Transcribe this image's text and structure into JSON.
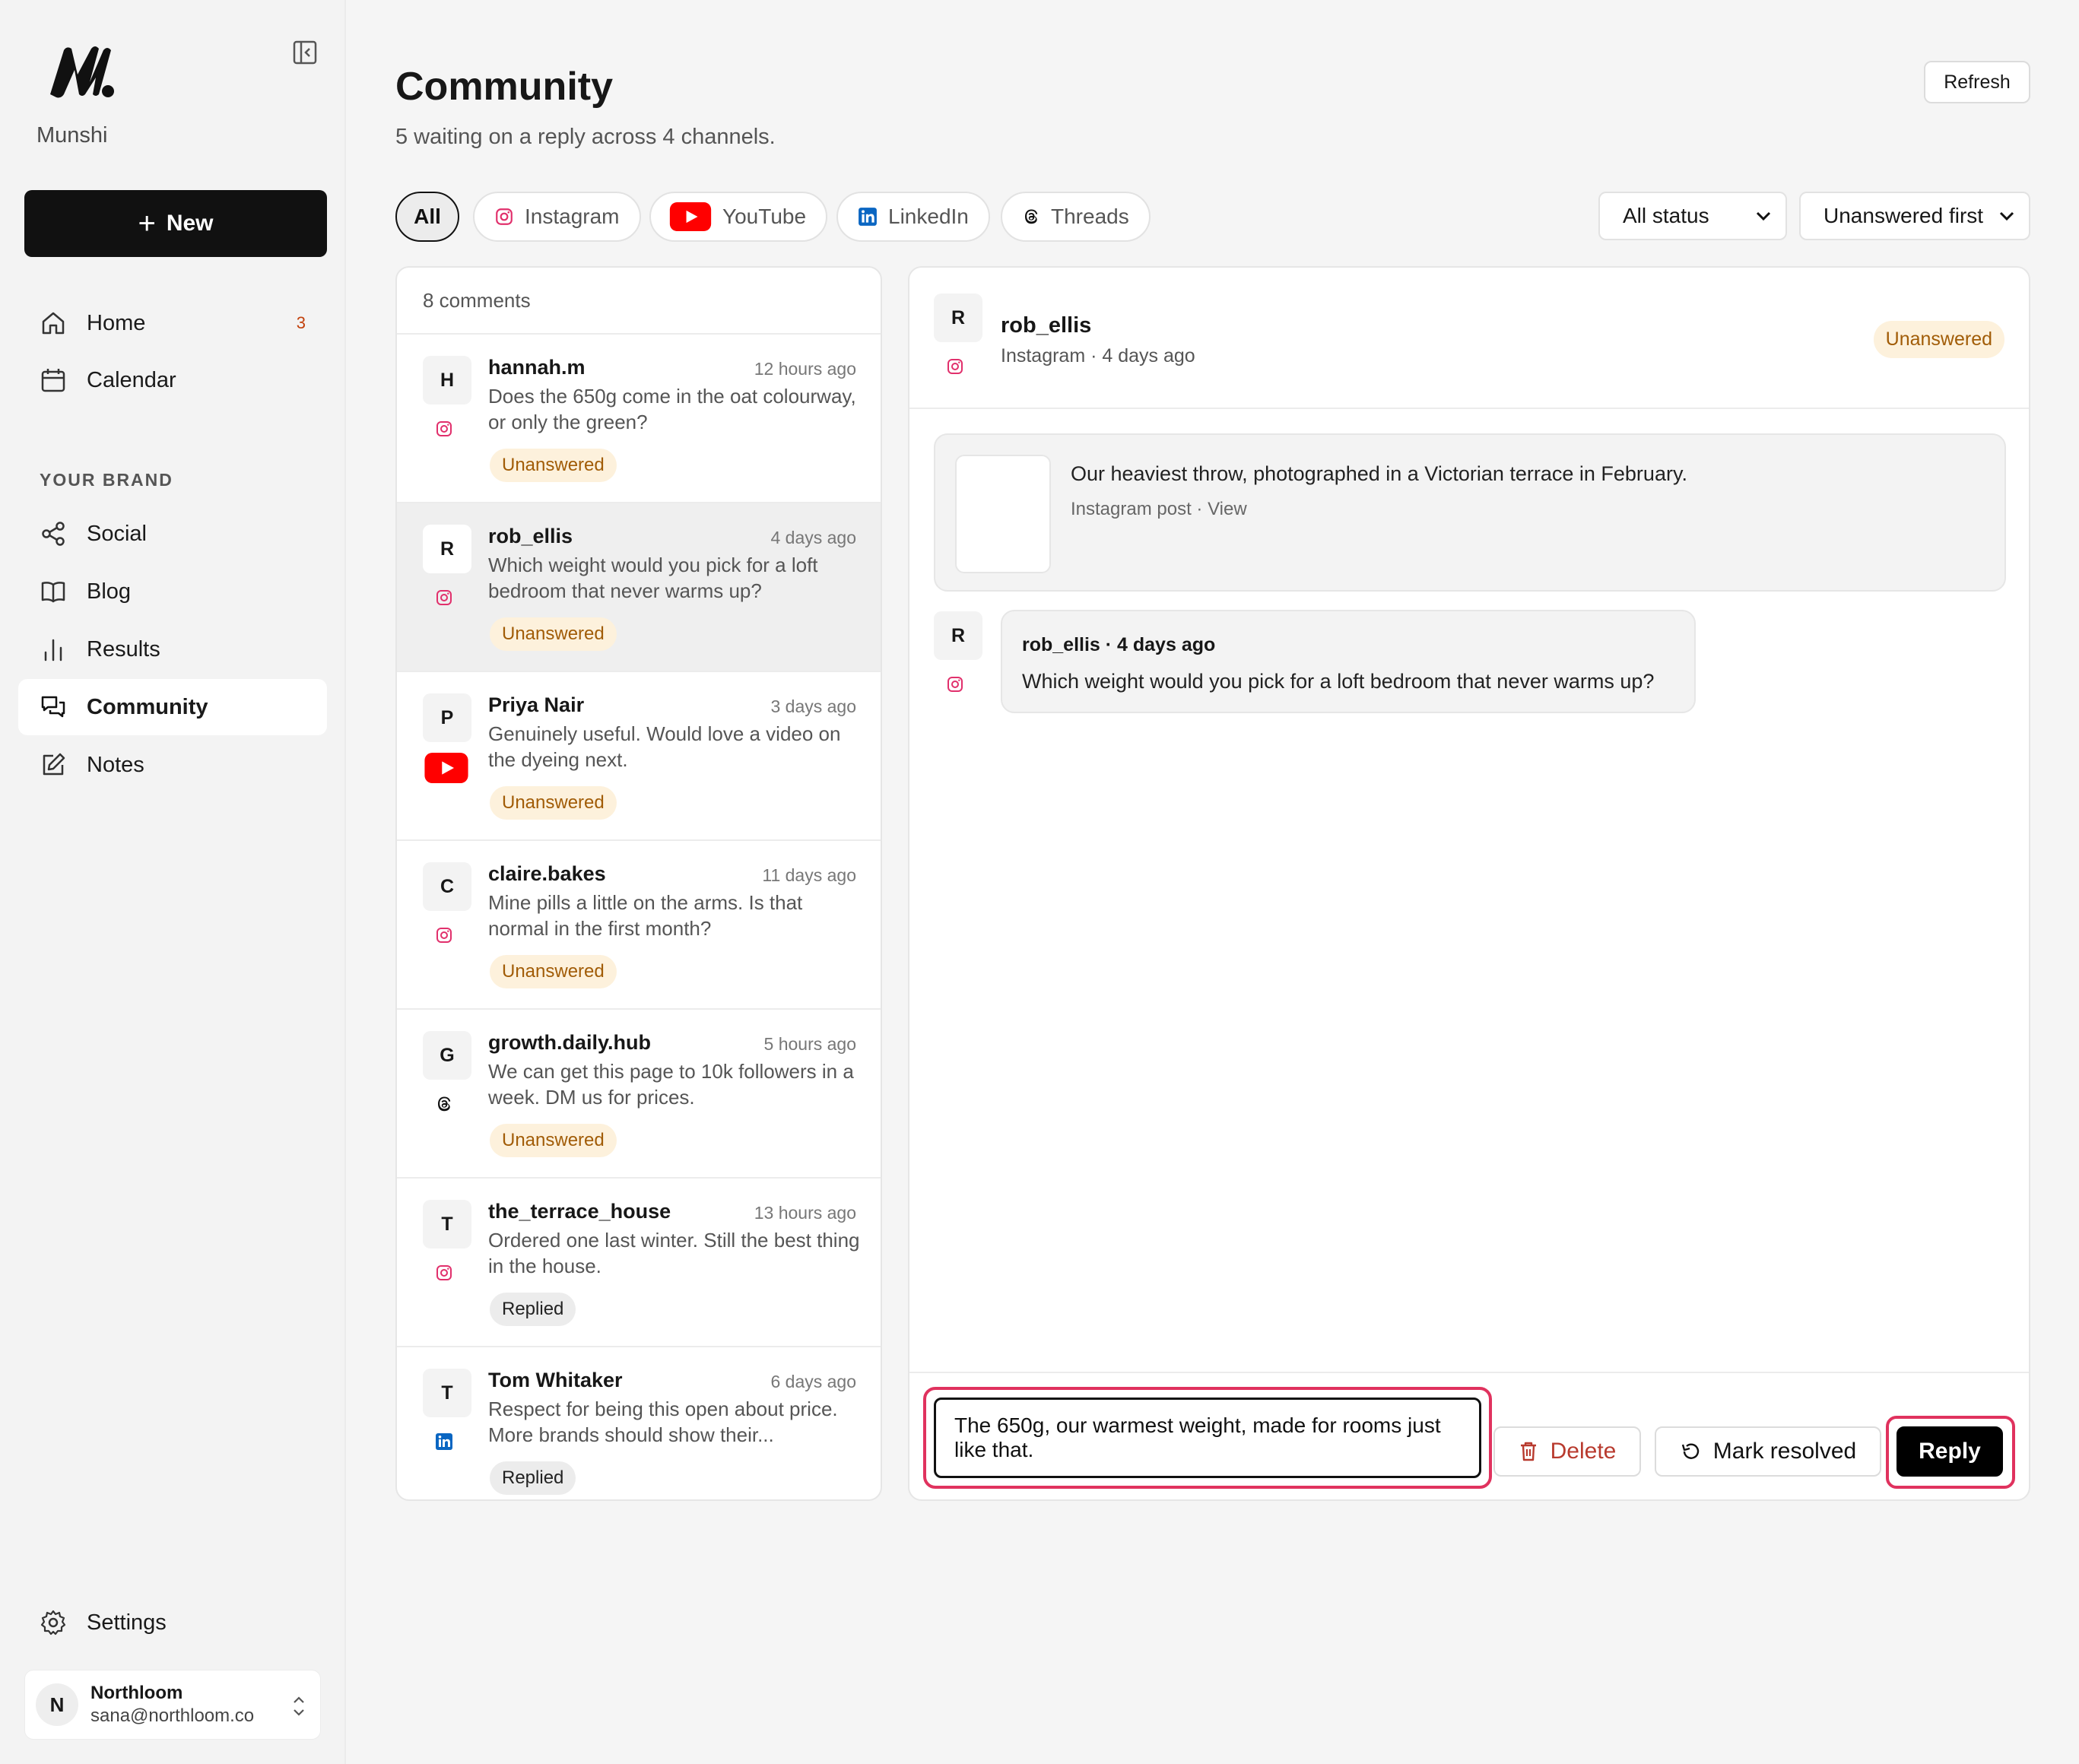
{
  "app": {
    "name": "Munshi"
  },
  "sidebar": {
    "new_label": "New",
    "nav": [
      {
        "label": "Home",
        "icon": "home-icon",
        "badge": "3"
      },
      {
        "label": "Calendar",
        "icon": "calendar-icon"
      }
    ],
    "section_label": "YOUR BRAND",
    "brand_nav": [
      {
        "label": "Social",
        "icon": "share-icon"
      },
      {
        "label": "Blog",
        "icon": "book-icon"
      },
      {
        "label": "Results",
        "icon": "bar-chart-icon"
      },
      {
        "label": "Community",
        "icon": "chat-icon",
        "active": true
      },
      {
        "label": "Notes",
        "icon": "edit-icon"
      }
    ],
    "settings_label": "Settings",
    "account": {
      "initial": "N",
      "name": "Northloom",
      "email": "sana@northloom.co"
    }
  },
  "header": {
    "title": "Community",
    "subtitle": "5 waiting on a reply across 4 channels.",
    "refresh_label": "Refresh"
  },
  "filters": {
    "channels": [
      {
        "label": "All",
        "active": true
      },
      {
        "label": "Instagram",
        "icon": "instagram-icon"
      },
      {
        "label": "YouTube",
        "icon": "youtube-icon"
      },
      {
        "label": "LinkedIn",
        "icon": "linkedin-icon"
      },
      {
        "label": "Threads",
        "icon": "threads-icon"
      }
    ],
    "status_select": "All status",
    "sort_select": "Unanswered first"
  },
  "comments": {
    "count_label": "8 comments",
    "items": [
      {
        "initial": "H",
        "name": "hannah.m",
        "time": "12 hours ago",
        "text": "Does the 650g come in the oat colourway, or only the green?",
        "status": "Unanswered",
        "platform": "instagram"
      },
      {
        "initial": "R",
        "name": "rob_ellis",
        "time": "4 days ago",
        "text": "Which weight would you pick for a loft bedroom that never warms up?",
        "status": "Unanswered",
        "platform": "instagram",
        "selected": true
      },
      {
        "initial": "P",
        "name": "Priya Nair",
        "time": "3 days ago",
        "text": "Genuinely useful. Would love a video on the dyeing next.",
        "status": "Unanswered",
        "platform": "youtube"
      },
      {
        "initial": "C",
        "name": "claire.bakes",
        "time": "11 days ago",
        "text": "Mine pills a little on the arms. Is that normal in the first month?",
        "status": "Unanswered",
        "platform": "instagram"
      },
      {
        "initial": "G",
        "name": "growth.daily.hub",
        "time": "5 hours ago",
        "text": "We can get this page to 10k followers in a week. DM us for prices.",
        "status": "Unanswered",
        "platform": "threads"
      },
      {
        "initial": "T",
        "name": "the_terrace_house",
        "time": "13 hours ago",
        "text": "Ordered one last winter. Still the best thing in the house.",
        "status": "Replied",
        "platform": "instagram"
      },
      {
        "initial": "T",
        "name": "Tom Whitaker",
        "time": "6 days ago",
        "text": "Respect for being this open about price. More brands should show their...",
        "status": "Replied",
        "platform": "linkedin"
      }
    ]
  },
  "detail": {
    "initial": "R",
    "name": "rob_ellis",
    "meta": "Instagram · 4 days ago",
    "status": "Unanswered",
    "post_text": "Our heaviest throw, photographed in a Victorian terrace in February.",
    "post_meta": "Instagram post · View",
    "message_header": "rob_ellis · 4 days ago",
    "message_text": "Which weight would you pick for a loft bedroom that never warms up?",
    "reply_value": "The 650g, our warmest weight, made for rooms just like that.",
    "delete_label": "Delete",
    "resolve_label": "Mark resolved",
    "reply_label": "Reply"
  },
  "colors": {
    "accent": "#111111",
    "unanswered_bg": "#fdf1dc",
    "unanswered_text": "#a15c07",
    "highlight": "#e0325e",
    "instagram": "#e1306c",
    "youtube": "#ff0000",
    "linkedin": "#0a66c2"
  }
}
